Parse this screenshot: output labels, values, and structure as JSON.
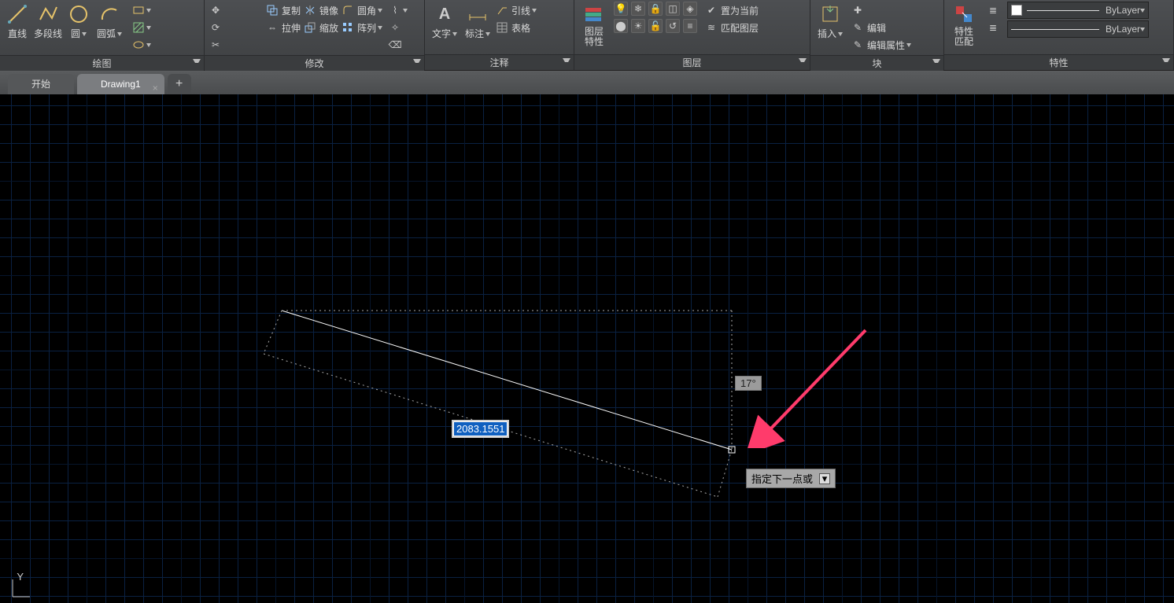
{
  "ribbon": {
    "draw": {
      "title": "绘图",
      "line": "直线",
      "polyline": "多段线",
      "circle": "圆",
      "arc": "圆弧"
    },
    "modify": {
      "title": "修改",
      "copy": "复制",
      "mirror": "镜像",
      "fillet": "圆角",
      "stretch": "拉伸",
      "scale": "缩放",
      "array": "阵列"
    },
    "annot": {
      "title": "注释",
      "text": "文字",
      "dim": "标注",
      "leader": "引线",
      "table": "表格"
    },
    "layer": {
      "title": "图层",
      "props": "图层\n特性",
      "setcur": "置为当前",
      "match": "匹配图层"
    },
    "block": {
      "title": "块",
      "insert": "插入",
      "edit": "编辑",
      "editattr": "编辑属性"
    },
    "prop": {
      "title": "特性",
      "match": "特性\n匹配",
      "bylayer1": "ByLayer",
      "bylayer2": "ByLayer"
    }
  },
  "tabs": {
    "start": "开始",
    "drawing": "Drawing1"
  },
  "canvas": {
    "length_value": "2083.1551",
    "angle_value": "17°",
    "prompt": "指定下一点或",
    "ucs_label": "Y"
  }
}
